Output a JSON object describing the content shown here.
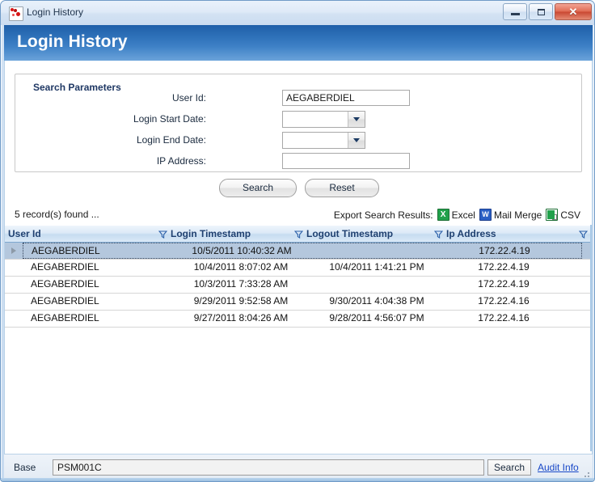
{
  "window": {
    "title": "Login History",
    "icon": "app-icon",
    "buttons": {
      "minimize": "minimize-icon",
      "maximize": "maximize-icon",
      "close": "✕"
    }
  },
  "banner": {
    "title": "Login History"
  },
  "search_panel": {
    "legend": "Search Parameters",
    "fields": [
      {
        "label": "User Id:",
        "value": "AEGABERDIEL",
        "type": "text"
      },
      {
        "label": "Login Start Date:",
        "value": "",
        "type": "combo"
      },
      {
        "label": "Login End Date:",
        "value": "",
        "type": "combo"
      },
      {
        "label": "IP Address:",
        "value": "",
        "type": "text"
      }
    ],
    "buttons": {
      "search": "Search",
      "reset": "Reset"
    }
  },
  "results_meta": {
    "records_found": "5 record(s) found ...",
    "export_label": "Export Search Results:",
    "export_options": [
      {
        "label": "Excel",
        "icon": "excel-icon"
      },
      {
        "label": "Mail Merge",
        "icon": "word-icon"
      },
      {
        "label": "CSV",
        "icon": "csv-icon"
      }
    ]
  },
  "grid": {
    "columns": [
      {
        "label": "User Id",
        "filter": false
      },
      {
        "label": "Login Timestamp",
        "filter": true
      },
      {
        "label": "Logout Timestamp",
        "filter": true
      },
      {
        "label": "Ip Address",
        "filter": true
      }
    ],
    "rows": [
      {
        "selected": true,
        "user_id": "AEGABERDIEL",
        "login_timestamp": "10/5/2011 10:40:32 AM",
        "logout_timestamp": "",
        "ip_address": "172.22.4.19"
      },
      {
        "selected": false,
        "user_id": "AEGABERDIEL",
        "login_timestamp": "10/4/2011 8:07:02 AM",
        "logout_timestamp": "10/4/2011 1:41:21 PM",
        "ip_address": "172.22.4.19"
      },
      {
        "selected": false,
        "user_id": "AEGABERDIEL",
        "login_timestamp": "10/3/2011 7:33:28 AM",
        "logout_timestamp": "",
        "ip_address": "172.22.4.19"
      },
      {
        "selected": false,
        "user_id": "AEGABERDIEL",
        "login_timestamp": "9/29/2011 9:52:58 AM",
        "logout_timestamp": "9/30/2011 4:04:38 PM",
        "ip_address": "172.22.4.16"
      },
      {
        "selected": false,
        "user_id": "AEGABERDIEL",
        "login_timestamp": "9/27/2011 8:04:26 AM",
        "logout_timestamp": "9/28/2011 4:56:07 PM",
        "ip_address": "172.22.4.16"
      }
    ]
  },
  "statusbar": {
    "label": "Base",
    "value": "PSM001C",
    "search_button": "Search",
    "audit_link": "Audit Info"
  },
  "colors": {
    "banner_start": "#1f5fa8",
    "banner_end": "#6ba3da",
    "header_text": "#1f4070",
    "link": "#1848c8",
    "selection": "#b4c7dd",
    "close_button": "#c94832"
  }
}
